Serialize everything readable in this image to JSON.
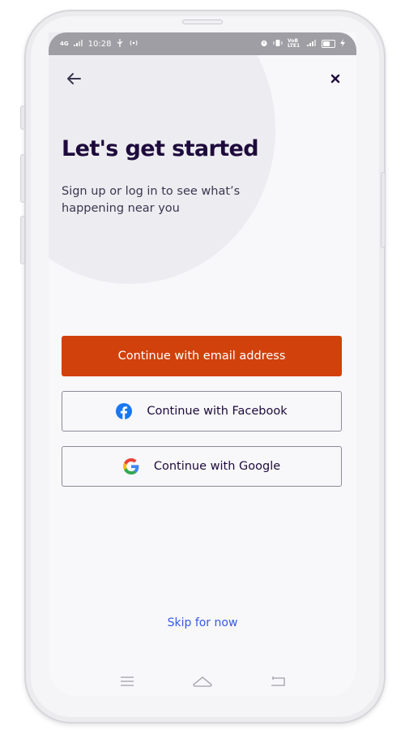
{
  "status_bar": {
    "network": "4G",
    "time": "10:28",
    "usb_icon": "usb-icon",
    "hotspot_icon": "hotspot-icon",
    "alarm_icon": "alarm-icon",
    "vibrate_icon": "vibrate-icon",
    "volte_label": "VoB LTE1",
    "signal_icon": "signal-icon",
    "battery_icon": "battery-icon",
    "charging_icon": "charging-icon"
  },
  "header": {
    "back_icon": "arrow-left-icon",
    "close_icon": "close-icon"
  },
  "main": {
    "title": "Let's get started",
    "subtitle": "Sign up or log in to see what’s happening near you"
  },
  "buttons": {
    "email_label": "Continue with email address",
    "facebook_label": "Continue with Facebook",
    "google_label": "Continue with Google"
  },
  "skip_label": "Skip for now",
  "nav_bar": {
    "menu_icon": "menu-icon",
    "home_icon": "home-icon",
    "back_icon": "back-nav-icon"
  },
  "colors": {
    "brand_orange": "#d1410c",
    "title_navy": "#1e0a3c",
    "link_blue": "#3659e3",
    "facebook_blue": "#1877f2",
    "google_blue": "#4285f4",
    "google_red": "#ea4335",
    "google_yellow": "#fbbc05",
    "google_green": "#34a853"
  }
}
